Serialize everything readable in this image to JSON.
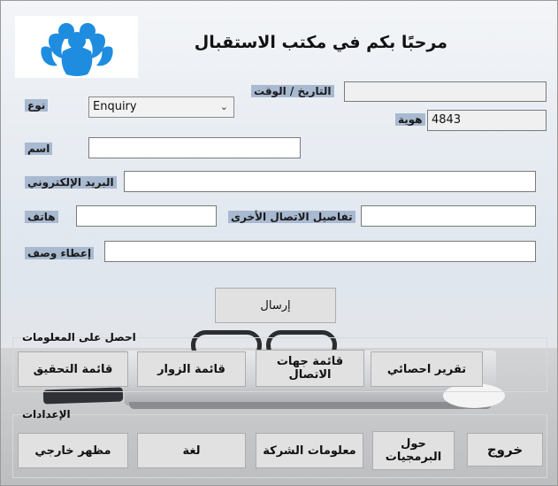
{
  "header": {
    "title": "مرحبًا بكم في مكتب الاستقبال",
    "logo_icon": "people-logo-icon"
  },
  "form": {
    "type_label": "نوع",
    "type_value": "Enquiry",
    "datetime_label": "التاريخ / الوقت",
    "datetime_value": "",
    "id_label": "هوية",
    "id_value": "4843",
    "name_label": "اسم",
    "name_value": "",
    "email_label": "البريد الإلكتروني",
    "email_value": "",
    "phone_label": "هاتف",
    "phone_value": "",
    "other_contact_label": "تفاصيل الاتصال الأخرى",
    "other_contact_value": "",
    "description_label": "إعطاء وصف",
    "description_value": "",
    "send_button": "إرسال"
  },
  "info_group": {
    "title": "احصل على المعلومات",
    "buttons": [
      "تقرير احصائي",
      "قائمة جهات الاتصال",
      "قائمة الزوار",
      "قائمة التحقيق"
    ]
  },
  "settings_group": {
    "title": "الإعدادات",
    "buttons": [
      "خروج",
      "حول البرمجيات",
      "معلومات الشركة",
      "لغة",
      "مظهر خارجي"
    ]
  },
  "colors": {
    "label_bg": "#a8b9d0",
    "logo": "#1e8de0"
  }
}
